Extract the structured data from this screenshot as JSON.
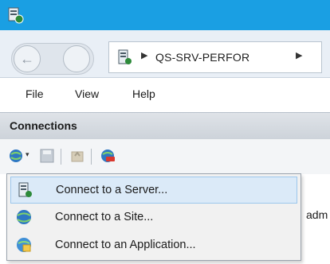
{
  "window": {
    "app_icon": "server-manager-icon",
    "accent": "#1a9fe3"
  },
  "nav": {
    "back_icon": "back-arrow-icon",
    "forward_icon": "forward-arrow-icon",
    "address_icon": "server-icon",
    "address_text": "QS-SRV-PERFOR",
    "sep_glyph": "▶"
  },
  "menu": {
    "items": [
      "File",
      "View",
      "Help"
    ]
  },
  "connections": {
    "title": "Connections",
    "toolbar": [
      "connect-dropdown-icon",
      "save-icon",
      "up-level-icon",
      "disconnect-icon"
    ],
    "peek_text": "adm"
  },
  "dropdown": {
    "items": [
      {
        "label": "Connect to a Server...",
        "icon": "server-icon",
        "highlighted": true
      },
      {
        "label": "Connect to a Site...",
        "icon": "globe-icon",
        "highlighted": false
      },
      {
        "label": "Connect to an Application...",
        "icon": "application-icon",
        "highlighted": false
      }
    ]
  }
}
